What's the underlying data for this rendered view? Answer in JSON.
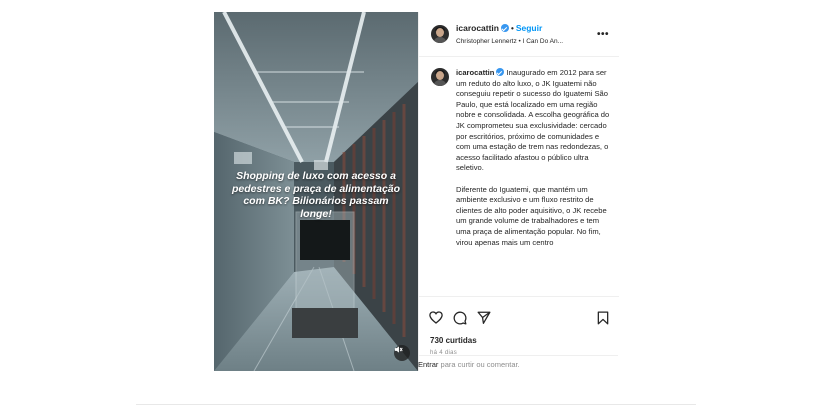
{
  "post": {
    "overlay_text": "Shopping de luxo com acesso a pedestres e praça de alimentação com BK? Bilionários passam longe!",
    "header": {
      "username": "icarocattin",
      "separator": "•",
      "follow_label": "Seguir",
      "audio": "Christopher Lennertz • I Can Do An...",
      "more_label": "•••"
    },
    "caption": {
      "username": "icarocattin",
      "paragraph1": "Inaugurado em 2012 para ser um reduto do alto luxo, o JK Iguatemi não conseguiu repetir o sucesso do Iguatemi São Paulo, que está localizado em uma região nobre e consolidada. A escolha geográfica do JK comprometeu sua exclusividade: cercado por escritórios, próximo de comunidades e com uma estação de trem nas redondezas, o acesso facilitado afastou o público ultra seletivo.",
      "paragraph2": "Diferente do Iguatemi, que mantém um ambiente exclusivo e um fluxo restrito de clientes de alto poder aquisitivo, o JK recebe um grande volume de trabalhadores e tem uma praça de alimentação popular. No fim, virou apenas mais um centro"
    },
    "likes": "730 curtidas",
    "time": "há 4 dias",
    "comment": {
      "enter": "Entrar",
      "rest": " para curtir ou comentar."
    }
  },
  "icons": [
    "heart-icon",
    "comment-icon",
    "share-icon",
    "bookmark-icon",
    "mute-icon",
    "verified-icon"
  ],
  "colors": {
    "link_blue": "#0095f6",
    "verified_blue": "#3897f0",
    "muted_gray": "#8e8e8e"
  }
}
